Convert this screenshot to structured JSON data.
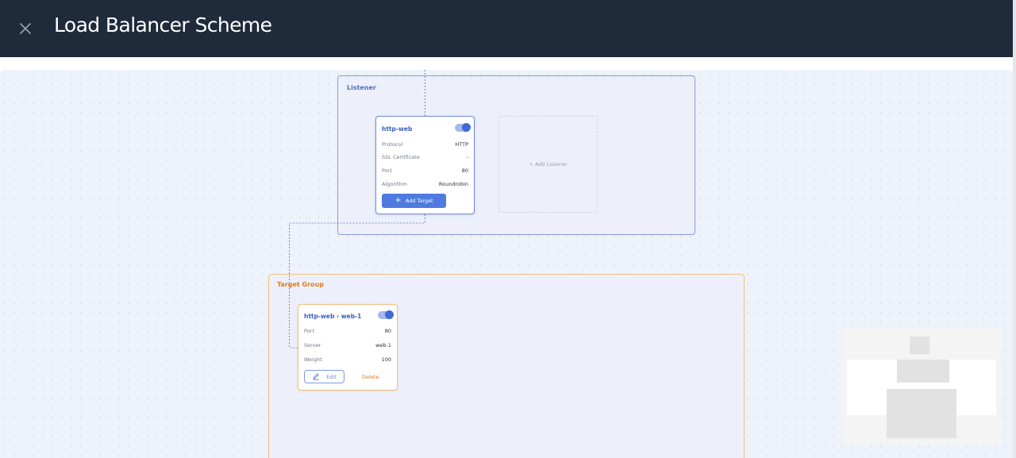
{
  "header": {
    "title": "Load Balancer Scheme",
    "close_icon": "close-icon"
  },
  "listener_group": {
    "label": "Listener",
    "card": {
      "name": "http-web",
      "enabled": true,
      "rows": [
        {
          "key": "Protocol",
          "value": "HTTP"
        },
        {
          "key": "SSL Certificate",
          "value": "-"
        },
        {
          "key": "Port",
          "value": "80"
        },
        {
          "key": "Algorithm",
          "value": "Roundrobin"
        }
      ],
      "add_target_label": "Add Target"
    },
    "add_listener_label": "+ Add Listener"
  },
  "target_group": {
    "label": "Target Group",
    "card": {
      "title": "http-web › web-1",
      "enabled": true,
      "rows": [
        {
          "key": "Port",
          "value": "80"
        },
        {
          "key": "Server",
          "value": "web-1"
        },
        {
          "key": "Weight",
          "value": "100"
        }
      ],
      "edit_label": "Edit",
      "delete_label": "Delete"
    }
  },
  "colors": {
    "header_bg": "#1f2a3b",
    "listener_accent": "#4a6fc0",
    "target_accent": "#e07b1c",
    "primary_button": "#4f7be0"
  }
}
